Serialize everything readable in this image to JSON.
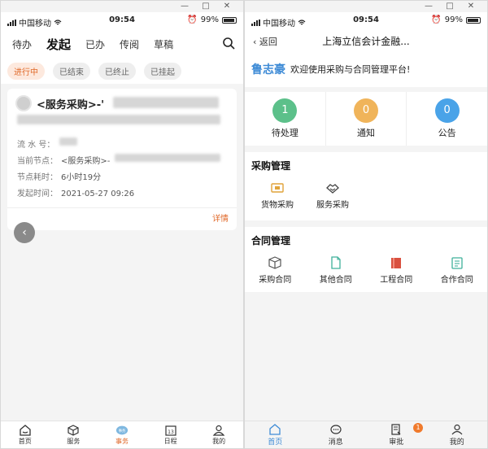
{
  "left": {
    "status": {
      "carrier": "中国移动",
      "time": "09:54",
      "battery": "99%"
    },
    "tabs": [
      "待办",
      "发起",
      "已办",
      "传阅",
      "草稿"
    ],
    "active_tab": "发起",
    "chips": [
      "进行中",
      "已结束",
      "已终止",
      "已挂起"
    ],
    "card": {
      "title": "<服务采购>-'",
      "fields": [
        {
          "label": "流 水 号：",
          "value": ""
        },
        {
          "label": "当前节点：",
          "value": "<服务采购>-"
        },
        {
          "label": "节点耗时：",
          "value": "6小时19分"
        },
        {
          "label": "发起时间：",
          "value": "2021-05-27 09:26"
        }
      ],
      "detail_link": "详情"
    },
    "nav": [
      {
        "label": "首页",
        "icon": "home-icon"
      },
      {
        "label": "服务",
        "icon": "cube-icon"
      },
      {
        "label": "事务",
        "icon": "cloud-task-icon"
      },
      {
        "label": "日程",
        "icon": "calendar-icon"
      },
      {
        "label": "我的",
        "icon": "user-icon"
      }
    ],
    "nav_calendar_num": "13",
    "nav_task_text": "事务"
  },
  "right": {
    "status": {
      "carrier": "中国移动",
      "time": "09:54",
      "battery": "99%"
    },
    "back_label": "返回",
    "title": "上海立信会计金融...",
    "user_name": "鲁志豪",
    "welcome_msg": "欢迎使用采购与合同管理平台!",
    "counters": [
      {
        "value": "1",
        "label": "待处理",
        "color": "#5cc08a"
      },
      {
        "value": "0",
        "label": "通知",
        "color": "#f0b45a"
      },
      {
        "value": "0",
        "label": "公告",
        "color": "#4aa3e8"
      }
    ],
    "procurement": {
      "title": "采购管理",
      "items": [
        {
          "label": "货物采购",
          "icon": "goods-icon"
        },
        {
          "label": "服务采购",
          "icon": "handshake-icon"
        }
      ]
    },
    "contracts": {
      "title": "合同管理",
      "items": [
        {
          "label": "采购合同",
          "icon": "box-icon"
        },
        {
          "label": "其他合同",
          "icon": "document-icon"
        },
        {
          "label": "工程合同",
          "icon": "folder-icon"
        },
        {
          "label": "合作合同",
          "icon": "clipboard-icon"
        }
      ]
    },
    "nav": [
      {
        "label": "首页",
        "icon": "home-icon"
      },
      {
        "label": "消息",
        "icon": "chat-icon"
      },
      {
        "label": "审批",
        "icon": "approval-icon"
      },
      {
        "label": "我的",
        "icon": "user-icon"
      }
    ],
    "approval_badge": "1"
  },
  "colors": {
    "accent_orange": "#e06a2b",
    "accent_blue": "#3e8bd6"
  }
}
